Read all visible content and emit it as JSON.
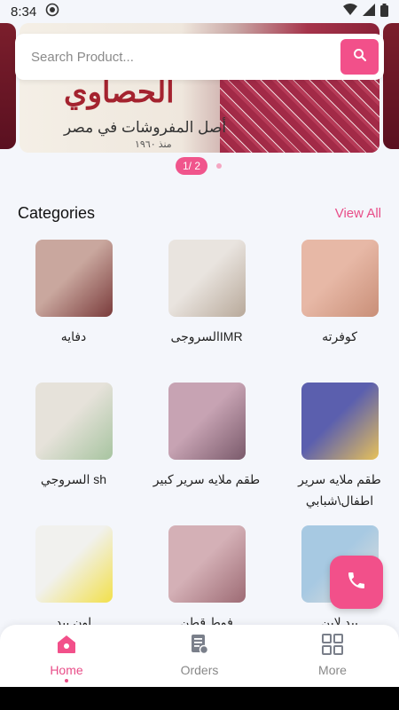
{
  "status": {
    "time": "8:34"
  },
  "banner": {
    "brand": "الحصاوي",
    "tagline": "أصل المفروشات في مصر",
    "est": "منذ ١٩٦٠"
  },
  "search": {
    "placeholder": "Search Product..."
  },
  "pager": {
    "label": "1/ 2"
  },
  "categories": {
    "title": "Categories",
    "view_all": "View All",
    "items": [
      {
        "label": "دفايه",
        "colors": [
          "#c9a79e",
          "#7a3b3b"
        ]
      },
      {
        "label": "IMRالسروجى",
        "colors": [
          "#e9e4df",
          "#b8a99a"
        ]
      },
      {
        "label": "كوفرته",
        "colors": [
          "#e7b8a6",
          "#c98f78"
        ]
      },
      {
        "label": "sh السروجي",
        "colors": [
          "#e6e2da",
          "#a7c4a0"
        ]
      },
      {
        "label": "طقم ملايه سرير كبير",
        "colors": [
          "#c7a3b3",
          "#7a5a6b"
        ]
      },
      {
        "label": "طقم ملايه سرير اطفال\\شبابي",
        "colors": [
          "#5b5fae",
          "#e7c15a"
        ]
      },
      {
        "label": "اون بيد",
        "colors": [
          "#f1f1ee",
          "#f2e04a"
        ]
      },
      {
        "label": "فوط قطن",
        "colors": [
          "#d4b0b6",
          "#9d6b74"
        ]
      },
      {
        "label": "بيد لاين",
        "colors": [
          "#a7c9e2",
          "#e7e1da"
        ]
      }
    ]
  },
  "nav": {
    "home": "Home",
    "orders": "Orders",
    "more": "More"
  },
  "theme": {
    "accent": "#f2508a"
  }
}
